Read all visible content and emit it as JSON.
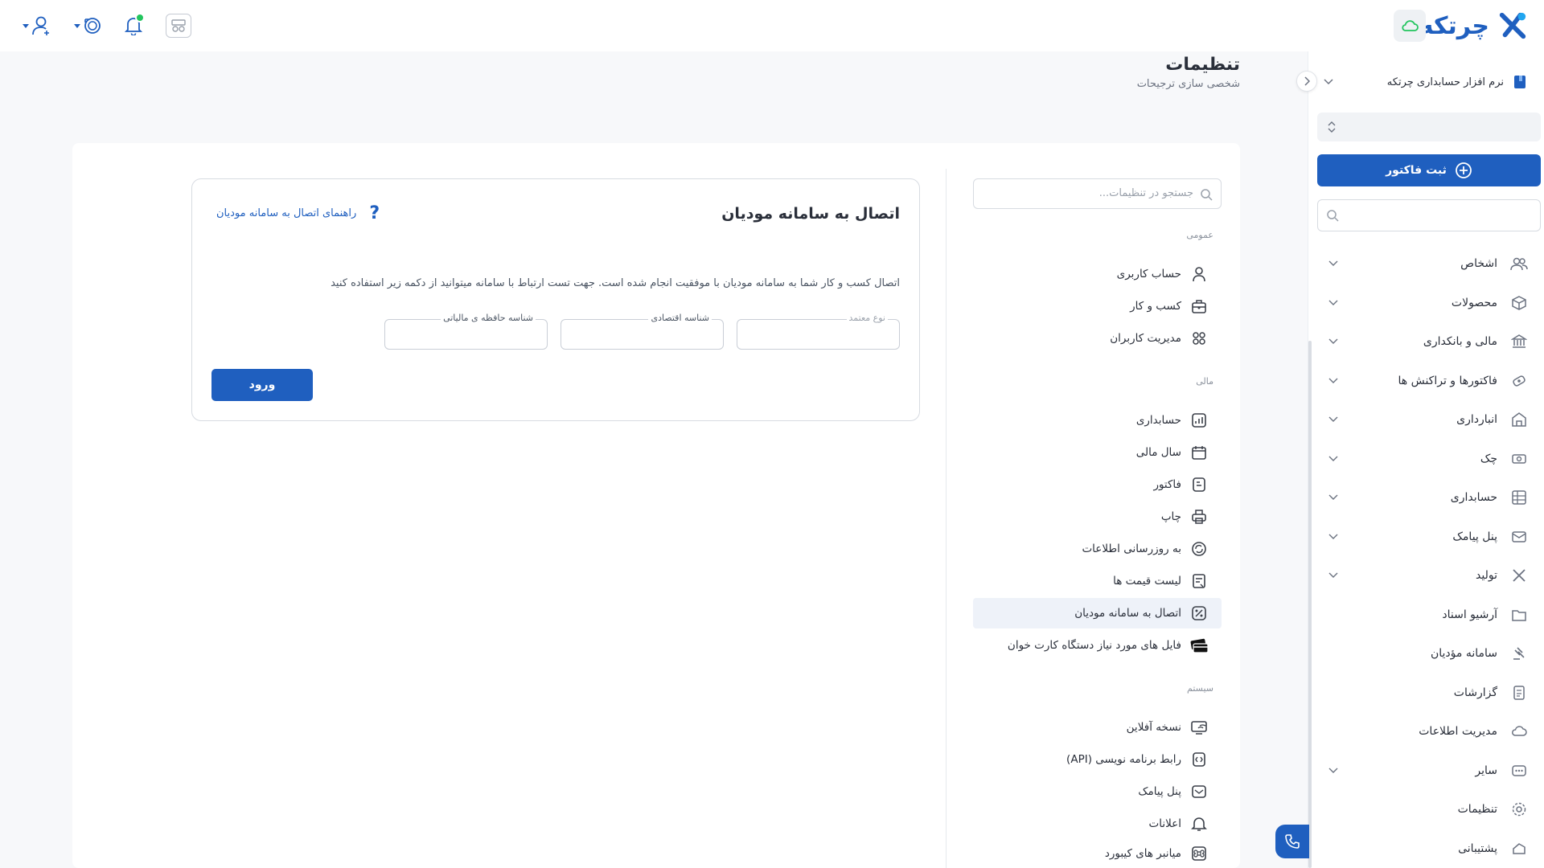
{
  "brand": {
    "name": "چرتکه",
    "accent": "#1f5fbf"
  },
  "topbar": {
    "icons": [
      "user-icon",
      "coin-icon",
      "bell-icon",
      "financial-calc-icon",
      "cloud-icon"
    ],
    "notification_badge_color": "#22c55e"
  },
  "sidebar": {
    "company": "نرم افزار حسابداری چرتکه",
    "fiscal_year": "",
    "invoice_button": "ثبت فاکتور",
    "search_placeholder": "",
    "items": [
      {
        "label": "اشخاص",
        "icon": "people-icon",
        "expandable": true
      },
      {
        "label": "محصولات",
        "icon": "box-icon",
        "expandable": true
      },
      {
        "label": "مالی و بانکداری",
        "icon": "bank-icon",
        "expandable": true
      },
      {
        "label": "فاکتورها و تراکنش ها",
        "icon": "transaction-icon",
        "expandable": true
      },
      {
        "label": "انبارداری",
        "icon": "warehouse-icon",
        "expandable": true
      },
      {
        "label": "چک",
        "icon": "check-icon",
        "expandable": true
      },
      {
        "label": "حسابداری",
        "icon": "ledger-icon",
        "expandable": true
      },
      {
        "label": "پنل پیامک",
        "icon": "sms-icon",
        "expandable": true
      },
      {
        "label": "تولید",
        "icon": "production-icon",
        "expandable": true
      },
      {
        "label": "آرشیو اسناد",
        "icon": "archive-icon",
        "expandable": false
      },
      {
        "label": "سامانه مؤدیان",
        "icon": "gavel-icon",
        "expandable": false
      },
      {
        "label": "گزارشات",
        "icon": "report-icon",
        "expandable": false
      },
      {
        "label": "مدیریت اطلاعات",
        "icon": "data-cloud-icon",
        "expandable": false
      },
      {
        "label": "سایر",
        "icon": "more-icon",
        "expandable": true
      },
      {
        "label": "تنظیمات",
        "icon": "gear-icon",
        "expandable": false
      },
      {
        "label": "پشتیبانی",
        "icon": "support-icon",
        "expandable": false
      }
    ]
  },
  "page": {
    "title": "تنظیمات",
    "subtitle": "شخصی سازی ترجیحات"
  },
  "settings_nav": {
    "search_placeholder": "جستجو در تنظیمات...",
    "groups": [
      {
        "title": "عمومی",
        "items": [
          {
            "label": "حساب کاربری",
            "icon": "user-icon"
          },
          {
            "label": "کسب و کار",
            "icon": "briefcase-icon"
          },
          {
            "label": "مدیریت کاربران",
            "icon": "users-manage-icon"
          }
        ]
      },
      {
        "title": "مالی",
        "items": [
          {
            "label": "حسابداری",
            "icon": "chart-icon"
          },
          {
            "label": "سال مالی",
            "icon": "calendar-icon"
          },
          {
            "label": "فاکتور",
            "icon": "invoice-icon"
          },
          {
            "label": "چاپ",
            "icon": "printer-icon"
          },
          {
            "label": "به روزرسانی اطلاعات",
            "icon": "refresh-icon"
          },
          {
            "label": "لیست قیمت ها",
            "icon": "price-list-icon"
          },
          {
            "label": "اتصال به سامانه مودیان",
            "icon": "tax-connect-icon",
            "active": true
          },
          {
            "label": "فایل های مورد نیاز دستگاه کارت خوان",
            "icon": "pos-cards-icon"
          }
        ]
      },
      {
        "title": "سیستم",
        "items": [
          {
            "label": "نسخه آفلاین",
            "icon": "offline-icon"
          },
          {
            "label": "رابط برنامه نویسی (API)",
            "icon": "api-icon"
          },
          {
            "label": "پنل پیامک",
            "icon": "sms-icon"
          },
          {
            "label": "اعلانات",
            "icon": "bell-icon"
          },
          {
            "label": "میانبر های کیبورد",
            "icon": "keyboard-cmd-icon"
          }
        ]
      }
    ]
  },
  "panel": {
    "title": "اتصال به سامانه مودیان",
    "guide_link": "راهنمای اتصال به سامانه مودیان",
    "description": "اتصال کسب و کار شما به سامانه مودیان با موفقیت انجام شده است. جهت تست ارتباط با سامانه میتوانید از دکمه زیر استفاده کنید",
    "fields": [
      {
        "label": "نوع معتمد",
        "value": ""
      },
      {
        "label": "شناسه اقتصادی",
        "value": ""
      },
      {
        "label": "شناسه حافظه ی مالیاتی",
        "value": ""
      }
    ],
    "login_button": "ورود"
  }
}
